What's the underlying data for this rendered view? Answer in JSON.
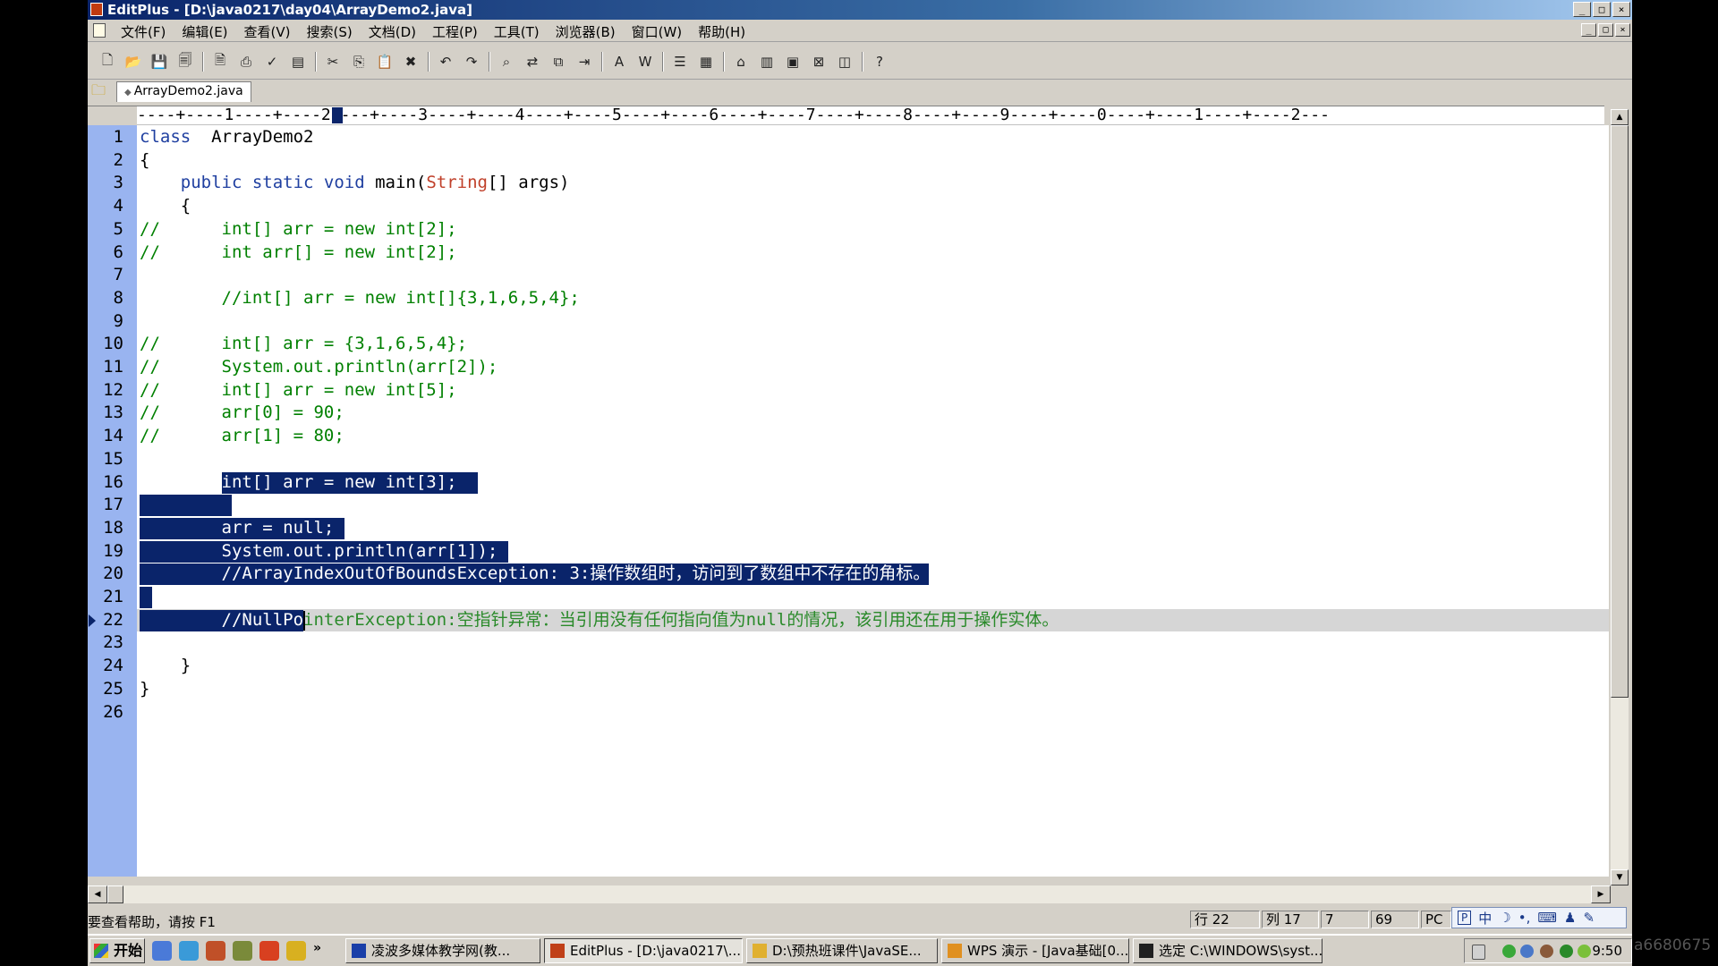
{
  "window": {
    "title": "EditPlus - [D:\\java0217\\day04\\ArrayDemo2.java]",
    "caption_buttons": [
      "_",
      "□",
      "×"
    ]
  },
  "menu": {
    "items": [
      "文件(F)",
      "编辑(E)",
      "查看(V)",
      "搜索(S)",
      "文档(D)",
      "工程(P)",
      "工具(T)",
      "浏览器(B)",
      "窗口(W)",
      "帮助(H)"
    ]
  },
  "toolbar": {
    "buttons": [
      {
        "icon": "new-file-icon",
        "glyph": "🗋"
      },
      {
        "icon": "open-icon",
        "glyph": "📂"
      },
      {
        "icon": "save-icon",
        "glyph": "💾"
      },
      {
        "icon": "save-all-icon",
        "glyph": "🗐"
      },
      {
        "icon": "print-preview-icon",
        "glyph": "🗎"
      },
      {
        "icon": "print-icon",
        "glyph": "⎙"
      },
      {
        "icon": "spellcheck-icon",
        "glyph": "✓"
      },
      {
        "icon": "page-icon",
        "glyph": "▤"
      },
      {
        "icon": "cut-icon",
        "glyph": "✂"
      },
      {
        "icon": "copy-icon",
        "glyph": "⎘"
      },
      {
        "icon": "paste-icon",
        "glyph": "📋"
      },
      {
        "icon": "delete-icon",
        "glyph": "✖"
      },
      {
        "icon": "undo-icon",
        "glyph": "↶"
      },
      {
        "icon": "redo-icon",
        "glyph": "↷"
      },
      {
        "icon": "find-icon",
        "glyph": "⌕"
      },
      {
        "icon": "replace-icon",
        "glyph": "⇄"
      },
      {
        "icon": "find-in-files-icon",
        "glyph": "⧉"
      },
      {
        "icon": "goto-icon",
        "glyph": "⇥"
      },
      {
        "icon": "font-icon",
        "glyph": "A"
      },
      {
        "icon": "word-wrap-icon",
        "glyph": "W"
      },
      {
        "icon": "line-number-icon",
        "glyph": "☰"
      },
      {
        "icon": "ruler-icon",
        "glyph": "▦"
      },
      {
        "icon": "view-browser-icon",
        "glyph": "⌂"
      },
      {
        "icon": "cliptext-icon",
        "glyph": "▥"
      },
      {
        "icon": "directory-icon",
        "glyph": "▣"
      },
      {
        "icon": "output-icon",
        "glyph": "⊠"
      },
      {
        "icon": "fullscreen-icon",
        "glyph": "◫"
      },
      {
        "icon": "help-icon",
        "glyph": "?"
      }
    ]
  },
  "tab": {
    "label": "ArrayDemo2.java"
  },
  "ruler": {
    "text": "----+----1----+----2----+----3----+----4----+----5----+----6----+----7----+----8----+----9----+----0----+----1----+----2---"
  },
  "editor": {
    "current_line": 22,
    "lines": [
      {
        "n": "1",
        "parts": [
          [
            "kw",
            "class"
          ],
          [
            "",
            "  ArrayDemo2"
          ]
        ]
      },
      {
        "n": "2",
        "parts": [
          [
            "",
            "{"
          ]
        ]
      },
      {
        "n": "3",
        "parts": [
          [
            "kw",
            "    public static void "
          ],
          [
            "",
            "main("
          ],
          [
            "cls",
            "String"
          ],
          [
            "",
            "[] args)"
          ]
        ]
      },
      {
        "n": "4",
        "parts": [
          [
            "",
            "    {"
          ]
        ]
      },
      {
        "n": "5",
        "parts": [
          [
            "cmt",
            "//      int[] arr = new int[2];"
          ]
        ]
      },
      {
        "n": "6",
        "parts": [
          [
            "cmt",
            "//      int arr[] = new int[2];"
          ]
        ]
      },
      {
        "n": "7",
        "parts": []
      },
      {
        "n": "8",
        "parts": [
          [
            "cmt",
            "        //int[] arr = new int[]{3,1,6,5,4};"
          ]
        ]
      },
      {
        "n": "9",
        "parts": []
      },
      {
        "n": "10",
        "parts": [
          [
            "cmt",
            "//      int[] arr = {3,1,6,5,4};"
          ]
        ]
      },
      {
        "n": "11",
        "parts": [
          [
            "cmt",
            "//      System.out.println(arr[2]);"
          ]
        ]
      },
      {
        "n": "12",
        "parts": [
          [
            "cmt",
            "//      int[] arr = new int[5];"
          ]
        ]
      },
      {
        "n": "13",
        "parts": [
          [
            "cmt",
            "//      arr[0] = 90;"
          ]
        ]
      },
      {
        "n": "14",
        "parts": [
          [
            "cmt",
            "//      arr[1] = 80;"
          ]
        ]
      },
      {
        "n": "15",
        "parts": []
      },
      {
        "n": "16",
        "parts": [
          [
            "",
            "        "
          ],
          [
            "w",
            "int[] arr = new int[3]; "
          ]
        ]
      },
      {
        "n": "17",
        "parts": []
      },
      {
        "n": "18",
        "parts": [
          [
            "",
            "        "
          ],
          [
            "w",
            "arr = null; "
          ]
        ]
      },
      {
        "n": "19",
        "parts": [
          [
            "",
            "        "
          ],
          [
            "w",
            "System.out.println(arr[1]); "
          ]
        ]
      },
      {
        "n": "20",
        "parts": [
          [
            "",
            "        "
          ],
          [
            "w",
            "//ArrayIndexOutOfBoundsException: 3:操作数组时，访问到了数组中不存在的角标。 "
          ]
        ]
      },
      {
        "n": "21",
        "parts": []
      },
      {
        "n": "22",
        "parts": [
          [
            "",
            "        "
          ],
          [
            "w",
            "//NullPo"
          ],
          [
            "g",
            "interException:空指针异常：当引用没有任何指向值为null的情况，该引用还在用于操作实体。"
          ]
        ]
      },
      {
        "n": "23",
        "parts": []
      },
      {
        "n": "24",
        "parts": [
          [
            "",
            "    }"
          ]
        ]
      },
      {
        "n": "25",
        "parts": [
          [
            "",
            "}"
          ]
        ]
      },
      {
        "n": "26",
        "parts": []
      }
    ]
  },
  "status": {
    "help": "要查看帮助，请按 F1",
    "row": "行 22",
    "col": "列 17",
    "c3": "7",
    "c4": "69",
    "mode": "PC"
  },
  "ime": {
    "items": [
      "中",
      "☽",
      "•,",
      "⌨",
      "♟",
      "✎"
    ]
  },
  "taskbar": {
    "start": "开始",
    "more": "»",
    "tasks": [
      {
        "label": "凌波多媒体教学网(教...",
        "color": "#1a3fa8"
      },
      {
        "label": "EditPlus - [D:\\java0217\\...",
        "color": "#c04018"
      },
      {
        "label": "D:\\预热班课件\\JavaSE...",
        "color": "#e0b030"
      },
      {
        "label": "WPS 演示 - [Java基础[0...",
        "color": "#e09020"
      },
      {
        "label": "选定 C:\\WINDOWS\\syst...",
        "color": "#202020"
      }
    ],
    "clock": "9:50"
  },
  "watermark": "a6680675"
}
